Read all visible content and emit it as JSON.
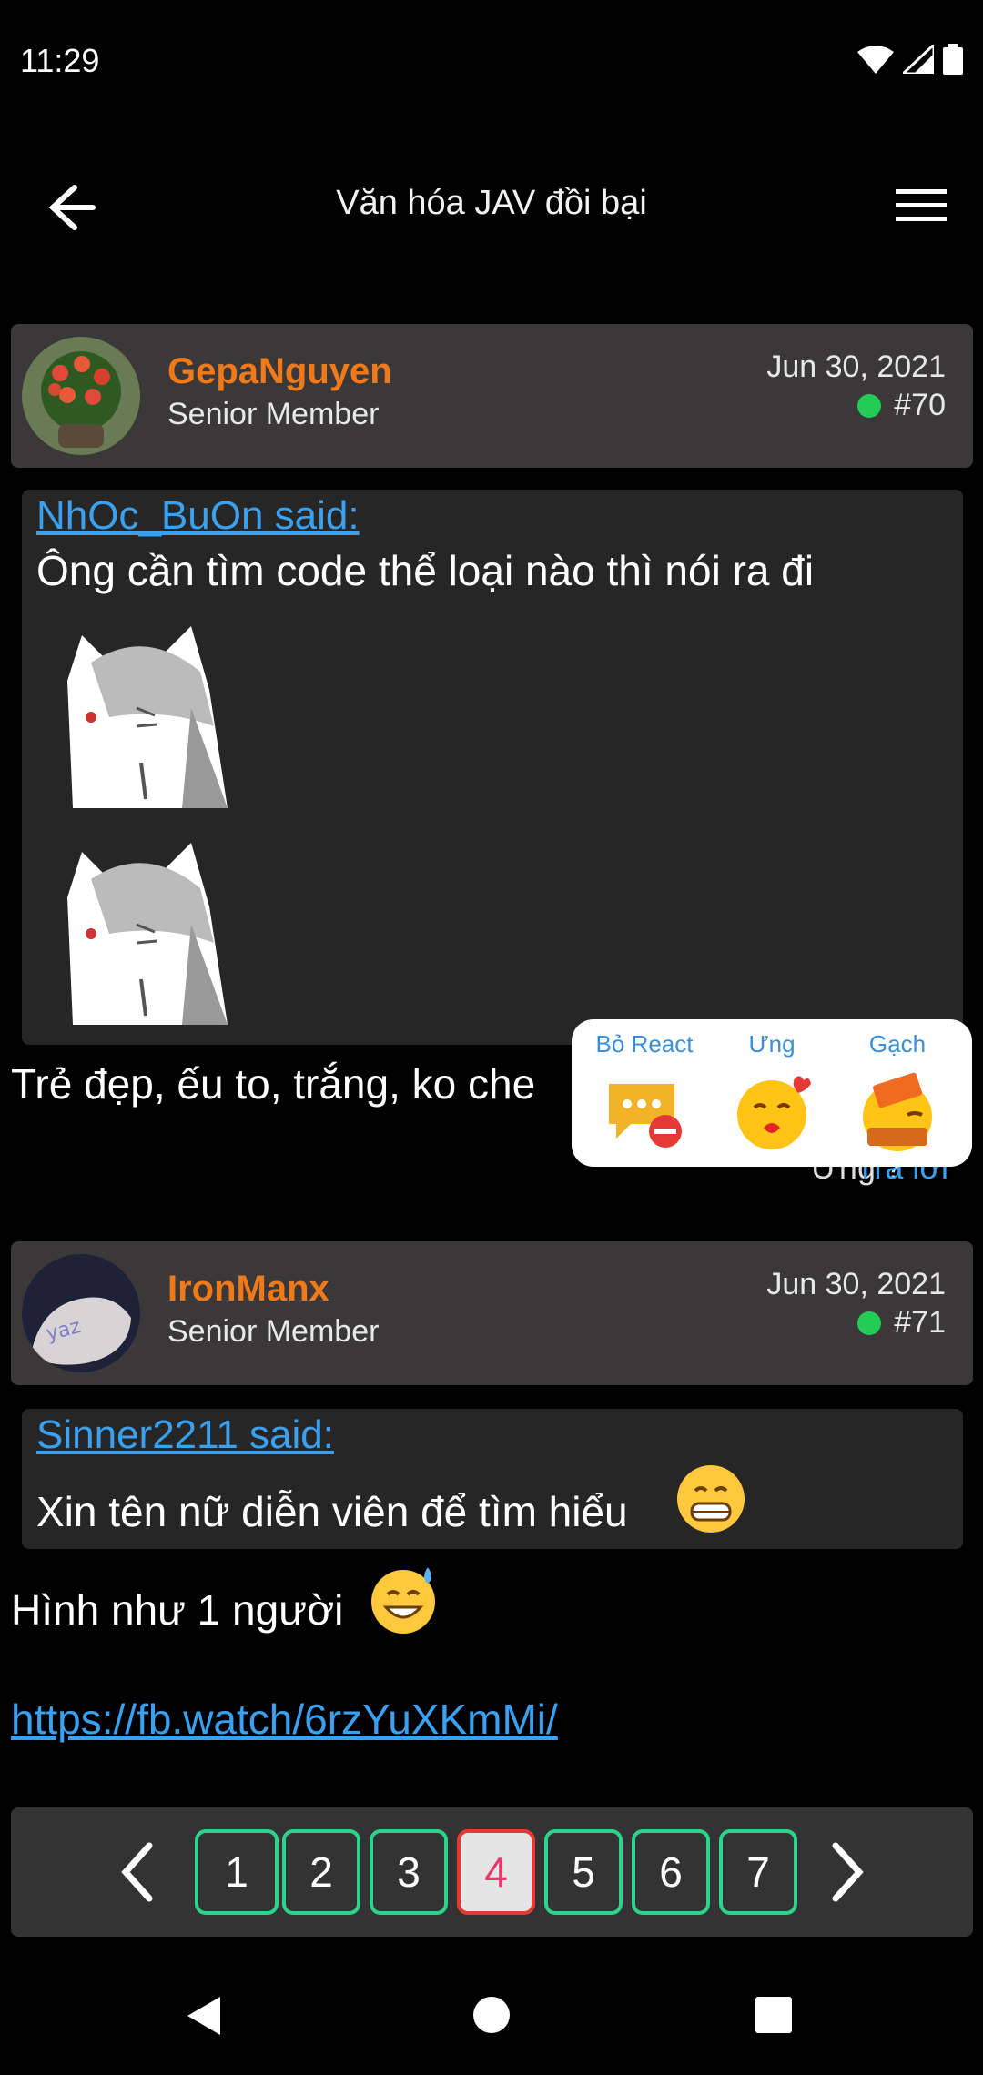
{
  "status": {
    "time": "11:29"
  },
  "appbar": {
    "title": "Văn hóa JAV đồi bại"
  },
  "posts": [
    {
      "username": "GepaNguyen",
      "role": "Senior Member",
      "date": "Jun 30, 2021",
      "number": "#70",
      "quote_author": "NhOc_BuOn said:",
      "quote_text": "Ông cần tìm code thể loại nào thì nói ra đi",
      "body": "Trẻ đẹp, ếu to, trắng, ko che",
      "footer_react": "Ưng ?",
      "footer_reply": "Trả lời"
    },
    {
      "username": "IronManx",
      "role": "Senior Member",
      "date": "Jun 30, 2021",
      "number": "#71",
      "quote_author": "Sinner2211 said:",
      "quote_text": "Xin tên nữ diễn viên để tìm hiểu",
      "body": "Hình như 1 người",
      "link": "https://fb.watch/6rzYuXKmMi/"
    }
  ],
  "react_popup": {
    "items": [
      {
        "label": "Bỏ React",
        "icon": "remove-react-icon"
      },
      {
        "label": "Ưng",
        "icon": "kiss-emoji-icon"
      },
      {
        "label": "Gạch",
        "icon": "brick-emoji-icon"
      }
    ]
  },
  "pagination": {
    "pages": [
      "1",
      "2",
      "3",
      "4",
      "5",
      "6",
      "7"
    ],
    "current": "4"
  },
  "colors": {
    "accent_orange": "#f07a1a",
    "link_blue": "#3aa0f0",
    "page_green": "#2bd48a",
    "page_active": "#e53935"
  }
}
